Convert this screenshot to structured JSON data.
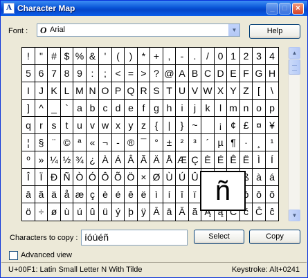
{
  "window": {
    "title": "Character Map",
    "app_icon": "charmap-icon"
  },
  "titlebar_buttons": {
    "minimize": "_",
    "maximize": "□",
    "close": "×"
  },
  "font": {
    "label": "Font :",
    "selected": "Arial",
    "font_icon": "O"
  },
  "help_label": "Help",
  "grid": {
    "rows": [
      [
        "!",
        "\"",
        "#",
        "$",
        "%",
        "&",
        "'",
        "(",
        ")",
        "*",
        "+",
        ",",
        "-",
        ".",
        "/",
        "0",
        "1",
        "2",
        "3",
        "4"
      ],
      [
        "5",
        "6",
        "7",
        "8",
        "9",
        ":",
        ";",
        "<",
        "=",
        ">",
        "?",
        "@",
        "A",
        "B",
        "C",
        "D",
        "E",
        "F",
        "G",
        "H"
      ],
      [
        "I",
        "J",
        "K",
        "L",
        "M",
        "N",
        "O",
        "P",
        "Q",
        "R",
        "S",
        "T",
        "U",
        "V",
        "W",
        "X",
        "Y",
        "Z",
        "[",
        "\\"
      ],
      [
        "]",
        "^",
        "_",
        "`",
        "a",
        "b",
        "c",
        "d",
        "e",
        "f",
        "g",
        "h",
        "i",
        "j",
        "k",
        "l",
        "m",
        "n",
        "o",
        "p"
      ],
      [
        "q",
        "r",
        "s",
        "t",
        "u",
        "v",
        "w",
        "x",
        "y",
        "z",
        "{",
        "|",
        "}",
        "~",
        " ",
        "¡",
        "¢",
        "£",
        "¤",
        "¥"
      ],
      [
        "¦",
        "§",
        "¨",
        "©",
        "ª",
        "«",
        "¬",
        "-",
        "®",
        "¯",
        "°",
        "±",
        "²",
        "³",
        "´",
        "µ",
        "¶",
        "·",
        "¸",
        "¹"
      ],
      [
        "º",
        "»",
        "¼",
        "½",
        "¾",
        "¿",
        "À",
        "Á",
        "Â",
        "Ã",
        "Ä",
        "Å",
        "Æ",
        "Ç",
        "È",
        "É",
        "Ê",
        "Ë",
        "Ì",
        "Í"
      ],
      [
        "Î",
        "Ï",
        "Ð",
        "Ñ",
        "Ò",
        "Ó",
        "Ô",
        "Õ",
        "Ö",
        "×",
        "Ø",
        "Ù",
        "Ú",
        "Û",
        "Ü",
        "Ý",
        "Þ",
        "ß",
        "à",
        "á"
      ],
      [
        "â",
        "ã",
        "ä",
        "å",
        "æ",
        "ç",
        "è",
        "é",
        "ê",
        "ë",
        "ì",
        "í",
        "î",
        "ï",
        "ð",
        "ñ",
        "ò",
        "ó",
        "ô",
        "õ"
      ],
      [
        "ö",
        "÷",
        "ø",
        "ù",
        "ú",
        "û",
        "ü",
        "ý",
        "þ",
        "ÿ",
        "Ā",
        "ā",
        "Ă",
        "ă",
        "Ą",
        "ą",
        "Ć",
        "ć",
        "Ĉ",
        "ĉ"
      ]
    ],
    "selected_row": 8,
    "selected_col": 15
  },
  "zoom_char": "ñ",
  "copy": {
    "label": "Characters to copy :",
    "value": "íóúéñ"
  },
  "select_label": "Select",
  "copy_label": "Copy",
  "advanced_view_label": "Advanced view",
  "status": {
    "left": "U+00F1: Latin Small Letter N With Tilde",
    "right": "Keystroke: Alt+0241"
  },
  "scroll": {
    "up": "▲",
    "down": "▼"
  }
}
